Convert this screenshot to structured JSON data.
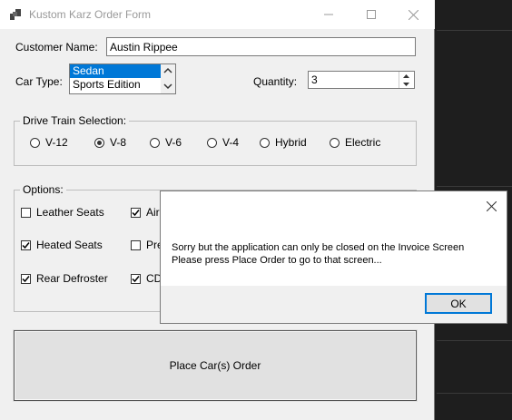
{
  "form": {
    "title": "Kustom Karz Order Form",
    "customer_name_label": "Customer Name:",
    "customer_name_value": "Austin Rippee",
    "car_type_label": "Car Type:",
    "car_types": [
      "Sedan",
      "Sports Edition"
    ],
    "car_type_selected": "Sedan",
    "quantity_label": "Quantity:",
    "quantity_value": "3",
    "drive_train": {
      "legend": "Drive Train Selection:",
      "options": [
        "V-12",
        "V-8",
        "V-6",
        "V-4",
        "Hybrid",
        "Electric"
      ],
      "selected": "V-8"
    },
    "options": {
      "legend": "Options:",
      "items": [
        {
          "label": "Leather Seats",
          "checked": false
        },
        {
          "label": "Air",
          "checked": true
        },
        {
          "label": "Heated Seats",
          "checked": true
        },
        {
          "label": "Pre",
          "checked": false
        },
        {
          "label": "Rear Defroster",
          "checked": true
        },
        {
          "label": "CD",
          "checked": true
        }
      ]
    },
    "place_order_label": "Place Car(s) Order"
  },
  "dialog": {
    "message_line1": "Sorry but the application can only be closed on the Invoice Screen",
    "message_line2": "Please press Place Order to go to that screen...",
    "ok_label": "OK"
  },
  "icons": {
    "app": "app-window-icon",
    "minimize": "minimize-icon",
    "maximize": "maximize-icon",
    "close": "close-icon",
    "scroll_up": "chevron-up-icon",
    "scroll_down": "chevron-down-icon",
    "spin_up": "triangle-up-icon",
    "spin_down": "triangle-down-icon"
  },
  "colors": {
    "selection": "#0078d7",
    "form_bg": "#f0f0f0",
    "desktop_bg": "#1e1e1e"
  }
}
